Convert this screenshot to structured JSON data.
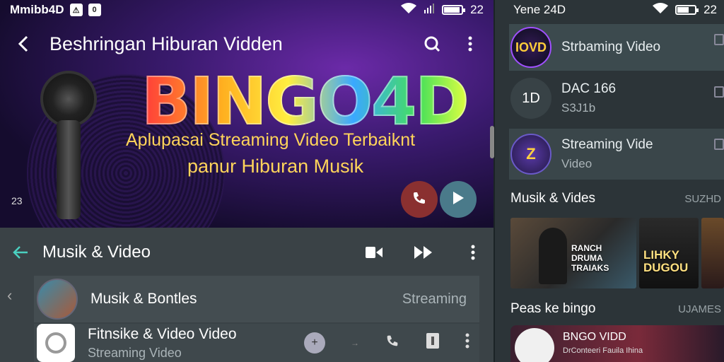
{
  "left": {
    "statusbar": {
      "title": "Mmibb4D",
      "badge1": "⚠",
      "badge2": "0",
      "time": "22",
      "battery_level": 0.85
    },
    "hero": {
      "title": "Beshringan Hiburan Vidden",
      "brand": "BINGO4D",
      "tagline1": "Aplupasai Streaming Video Terbaiknt",
      "tagline2": "panur Hiburan Musik",
      "corner_number": "23"
    },
    "section": {
      "title": "Musik & Video",
      "rows": [
        {
          "label": "Musik & Bontles",
          "meta": "Streaming"
        },
        {
          "label": "Fitnsike & Video Video",
          "sublabel": "Streaming Video"
        }
      ]
    }
  },
  "right": {
    "statusbar": {
      "title": "Yene 24D",
      "time": "22",
      "battery_level": 0.6
    },
    "items": [
      {
        "thumb": "IOVD",
        "title": "Strbaming Video",
        "subtitle": ""
      },
      {
        "thumb": "1D",
        "title": "DAC 166",
        "subtitle": "S3J1b"
      },
      {
        "thumb": "Z",
        "title": "Streaming Vide",
        "subtitle": "Video"
      }
    ],
    "section1": {
      "title": "Musik & Vides",
      "meta": "SUZHD"
    },
    "thumbs": [
      {
        "caption": "RANCH DRUMA TRAIAKS"
      },
      {
        "caption": "LIHKY DUGOU"
      },
      {
        "caption": ""
      }
    ],
    "section2": {
      "title": "Peas ke bingo",
      "meta": "UJAMES"
    },
    "feature": {
      "title": "BNGO VIDD",
      "subtitle": "DrConteeri Fauila Ihina"
    }
  }
}
